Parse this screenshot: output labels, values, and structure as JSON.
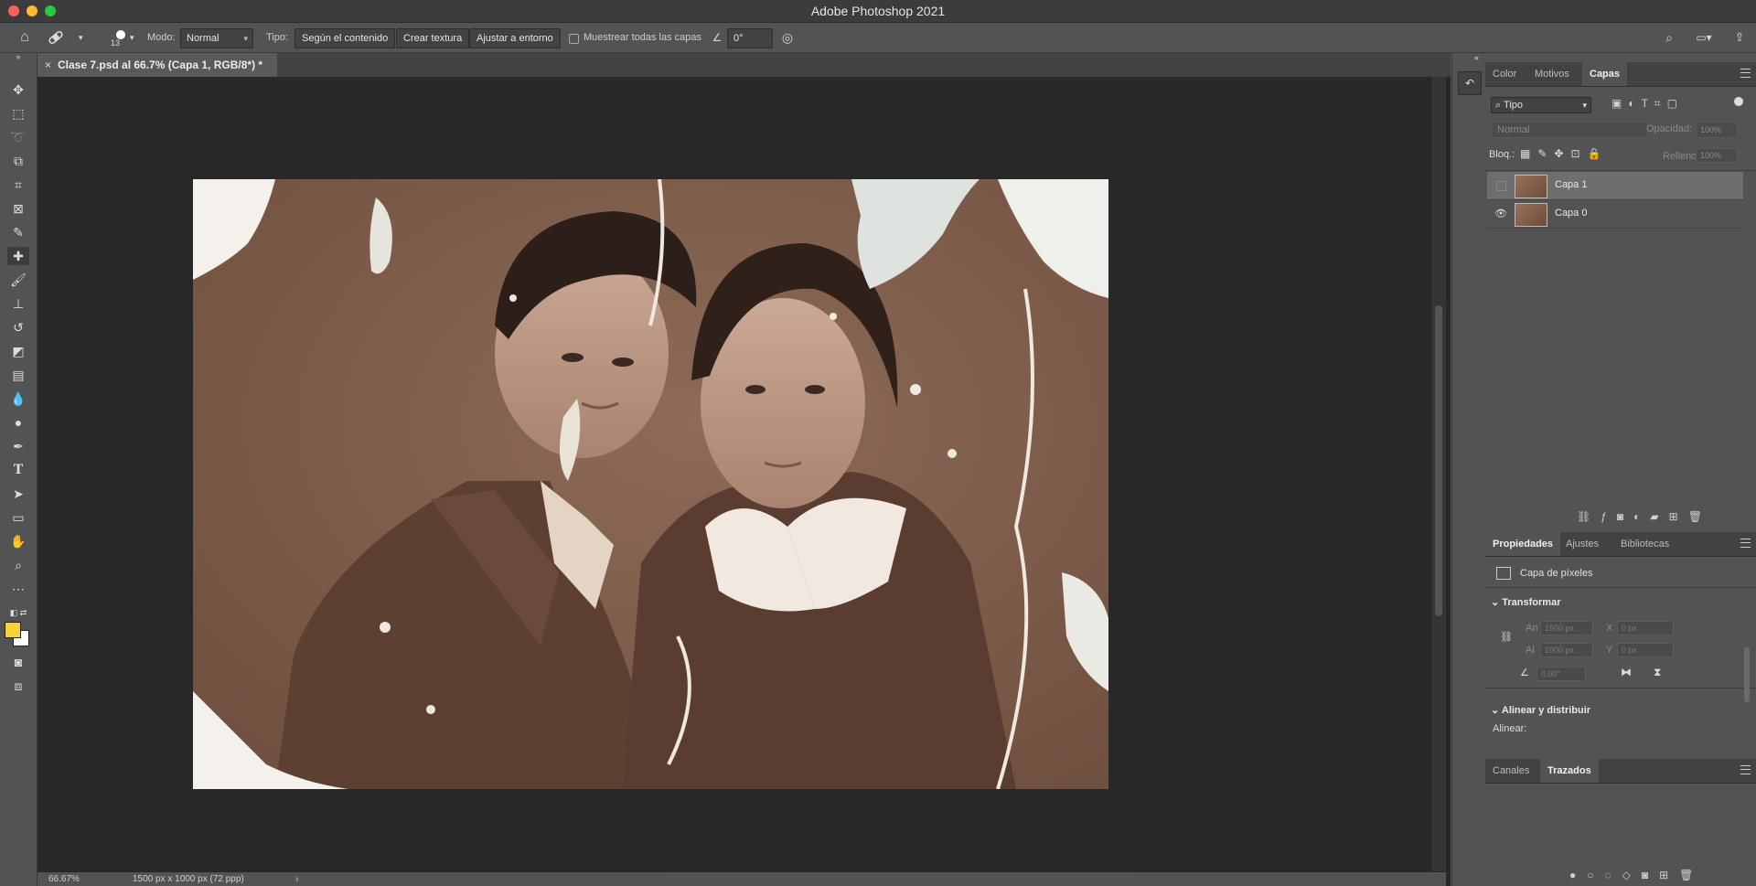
{
  "window": {
    "title": "Adobe Photoshop 2021"
  },
  "options_bar": {
    "brush_size": "13",
    "mode_label": "Modo:",
    "mode_value": "Normal",
    "type_label": "Tipo:",
    "type_options": [
      "Según el contenido",
      "Crear textura",
      "Ajustar a entorno"
    ],
    "sample_all_layers": "Muestrear todas las capas",
    "angle_value": "0°"
  },
  "document": {
    "tab_title": "Clase 7.psd al 66.7% (Capa 1, RGB/8*) *",
    "zoom": "66.67%",
    "doc_size": "1500 px x 1000 px (72 ppp)"
  },
  "top_panel": {
    "tabs": [
      "Color",
      "Motivos",
      "Capas"
    ],
    "active_tab": "Capas",
    "filter_kind": "Tipo",
    "blend_mode": "Normal",
    "opacity_label": "Opacidad:",
    "opacity_value": "100%",
    "lock_label": "Bloq.:",
    "fill_label": "Relleno:",
    "fill_value": "100%",
    "layers": [
      {
        "name": "Capa 1",
        "visible": false,
        "selected": true
      },
      {
        "name": "Capa 0",
        "visible": true,
        "selected": false
      }
    ]
  },
  "properties_panel": {
    "tabs": [
      "Propiedades",
      "Ajustes",
      "Bibliotecas"
    ],
    "active_tab": "Propiedades",
    "layer_type": "Capa de píxeles",
    "transform_heading": "Transformar",
    "width_label": "An",
    "width_value": "1500 px",
    "x_label": "X",
    "x_value": "0 px",
    "height_label": "Al",
    "height_value": "1000 px",
    "y_label": "Y",
    "y_value": "0 px",
    "angle_value": "0.00°",
    "align_heading": "Alinear y distribuir",
    "align_label": "Alinear:"
  },
  "bottom_panel": {
    "tabs": [
      "Canales",
      "Trazados"
    ],
    "active_tab": "Trazados"
  },
  "colors": {
    "foreground": "#f5d33a",
    "background": "#ffffff"
  }
}
